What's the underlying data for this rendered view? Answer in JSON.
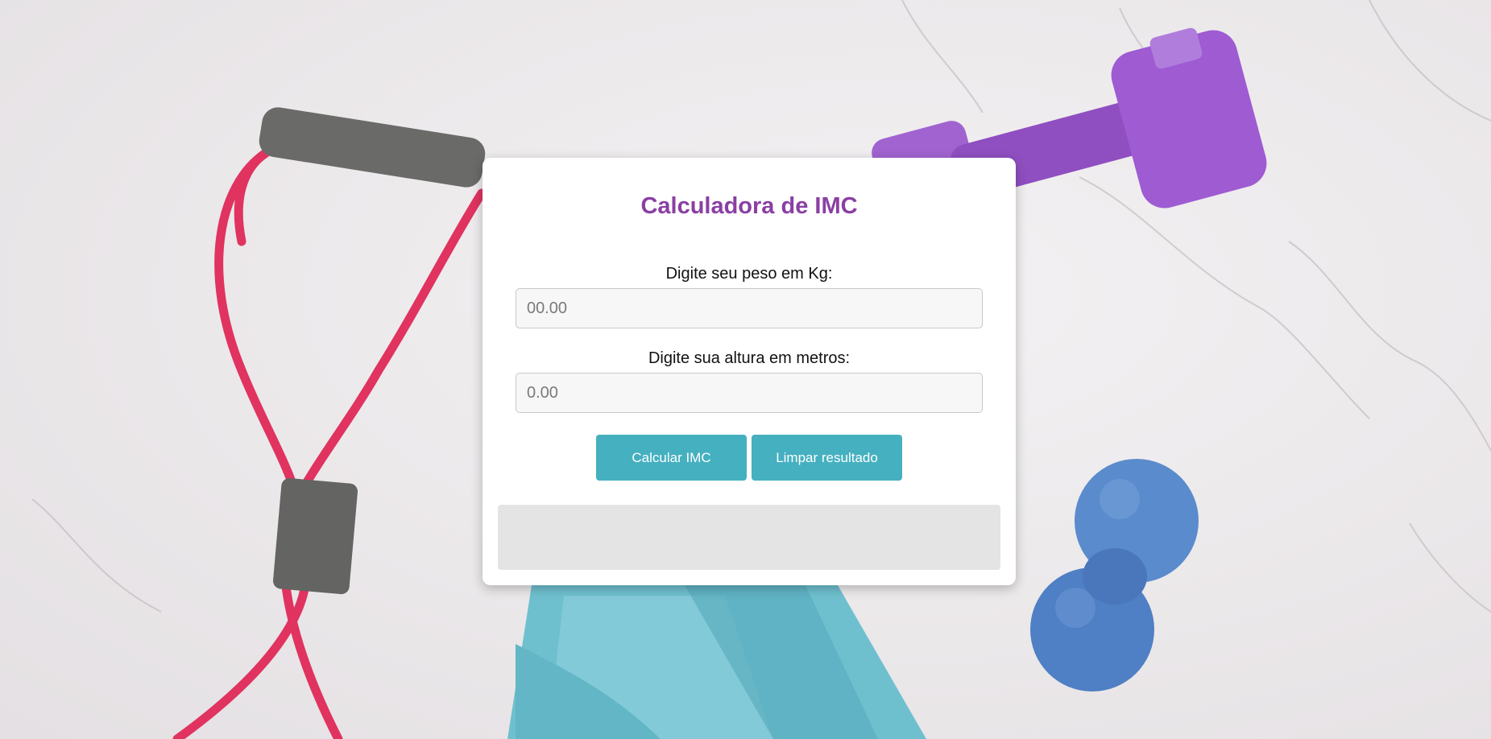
{
  "app": {
    "title": "Calculadora de IMC"
  },
  "form": {
    "peso": {
      "label": "Digite seu peso em Kg:",
      "placeholder": "00.00",
      "value": ""
    },
    "altura": {
      "label": "Digite sua altura em metros:",
      "placeholder": "0.00",
      "value": ""
    }
  },
  "buttons": {
    "calcular_label": "Calcular IMC",
    "limpar_label": "Limpar resultado"
  },
  "result": {
    "text": ""
  },
  "colors": {
    "title": "#8a3fa3",
    "button": "#45b0c0",
    "result_bg": "#e4e4e4",
    "card_bg": "#ffffff"
  },
  "background": {
    "items": [
      "resistance-band-red",
      "dumbbell-purple",
      "massage-ball-blue",
      "exercise-band-teal"
    ]
  }
}
